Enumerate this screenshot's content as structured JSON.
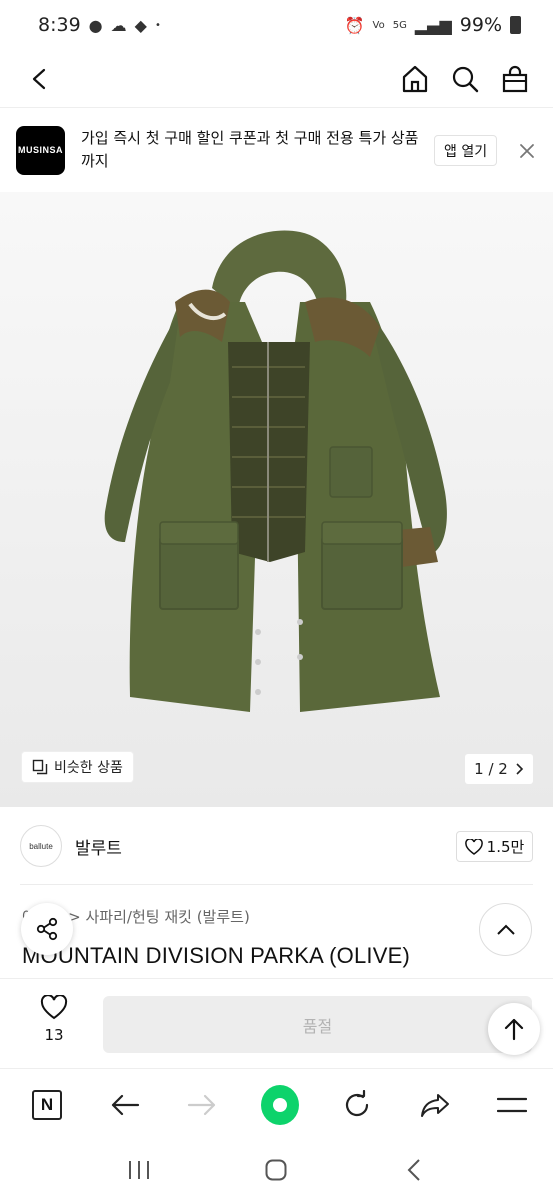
{
  "status_bar": {
    "time": "8:39",
    "battery": "99%",
    "network": "5G"
  },
  "banner": {
    "logo_text": "MUSINSA",
    "message": "가입 즉시 첫 구매 할인 쿠폰과 첫 구매 전용 특가 상품까지",
    "open_app_label": "앱 열기"
  },
  "product_image": {
    "similar_label": "비슷한 상품",
    "pager": "1 / 2"
  },
  "brand": {
    "logo_text": "ballute",
    "name": "발루트",
    "likes": "1.5만"
  },
  "product": {
    "category_path": "아우터 > 사파리/헌팅 재킷 (발루트)",
    "title": "MOUNTAIN DIVISION PARKA (OLIVE)"
  },
  "purchase": {
    "wish_count": "13",
    "soldout_label": "품절"
  },
  "colors": {
    "browser_green": "#0dd36b",
    "jacket_olive": "#5c6a3c"
  },
  "icons": [
    "back-icon",
    "home-icon",
    "search-icon",
    "bag-icon",
    "close-icon",
    "similar-icon",
    "chevron-right-icon",
    "heart-icon",
    "share-icon",
    "chevron-up-icon",
    "arrow-up-icon",
    "naver-icon",
    "arrow-left-icon",
    "arrow-right-icon",
    "refresh-icon",
    "forward-share-icon",
    "menu-icon"
  ]
}
